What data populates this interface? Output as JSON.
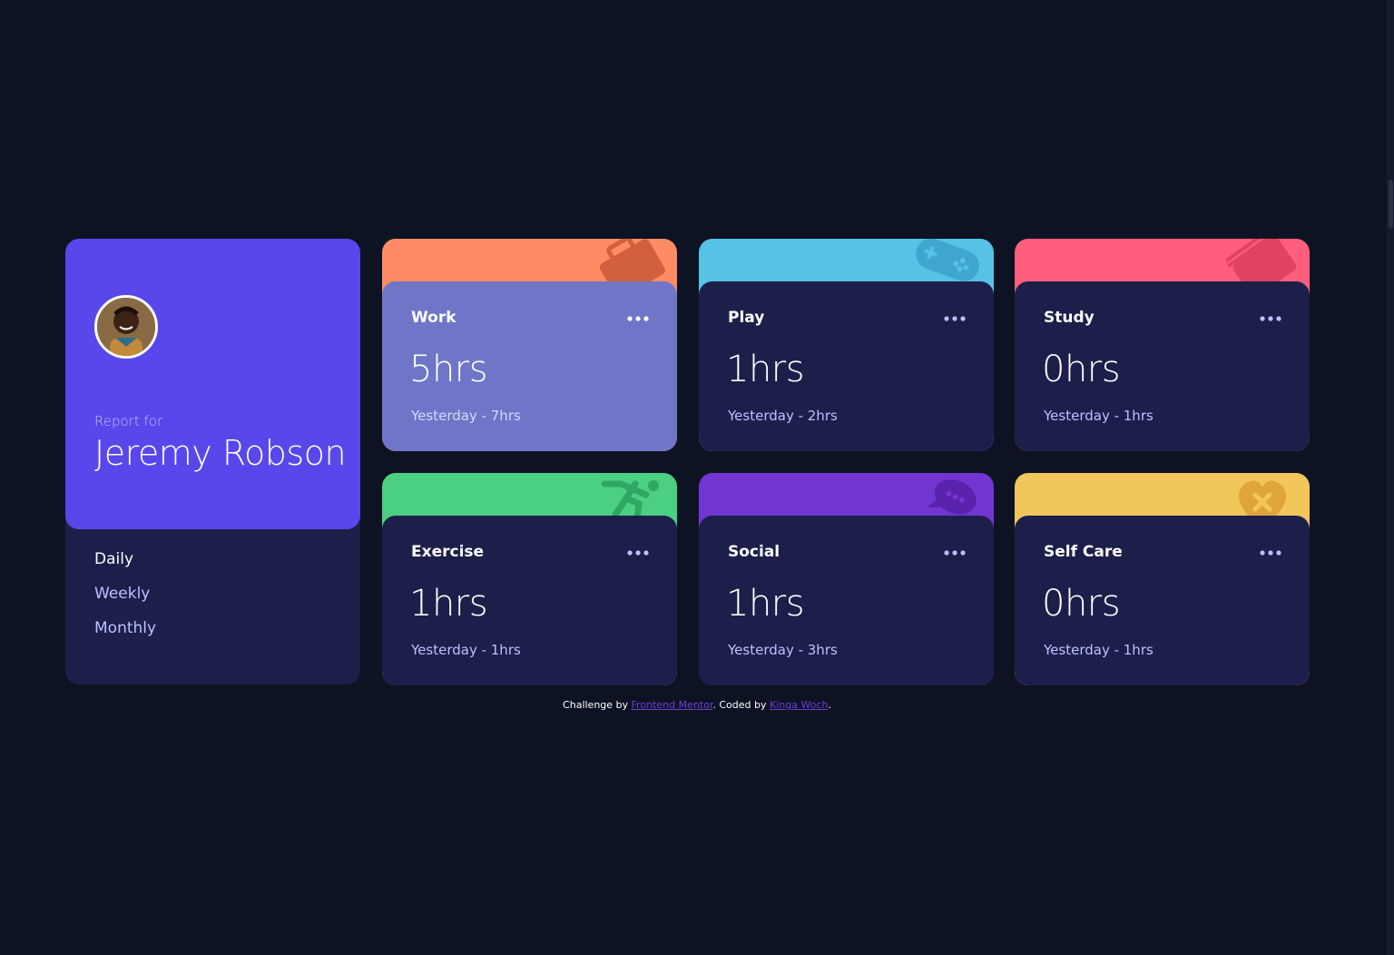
{
  "profile": {
    "report_label": "Report for",
    "name": "Jeremy Robson",
    "periods": [
      {
        "label": "Daily",
        "active": true
      },
      {
        "label": "Weekly",
        "active": false
      },
      {
        "label": "Monthly",
        "active": false
      }
    ]
  },
  "cards": [
    {
      "title": "Work",
      "hours": "5hrs",
      "previous": "Yesterday - 7hrs",
      "color": "#ff8b64",
      "icon": "briefcase-icon"
    },
    {
      "title": "Play",
      "hours": "1hrs",
      "previous": "Yesterday - 2hrs",
      "color": "#55c2e6",
      "icon": "gamepad-icon"
    },
    {
      "title": "Study",
      "hours": "0hrs",
      "previous": "Yesterday - 1hrs",
      "color": "#ff5e7d",
      "icon": "book-icon"
    },
    {
      "title": "Exercise",
      "hours": "1hrs",
      "previous": "Yesterday - 1hrs",
      "color": "#4bcf82",
      "icon": "running-icon"
    },
    {
      "title": "Social",
      "hours": "1hrs",
      "previous": "Yesterday - 3hrs",
      "color": "#7335d2",
      "icon": "chat-icon"
    },
    {
      "title": "Self Care",
      "hours": "0hrs",
      "previous": "Yesterday - 1hrs",
      "color": "#f1c75b",
      "icon": "heart-icon"
    }
  ],
  "footer": {
    "prefix": "Challenge by ",
    "link1": "Frontend Mentor",
    "middle": ". Coded by ",
    "link2": "Kinga Woch",
    "suffix": "."
  }
}
